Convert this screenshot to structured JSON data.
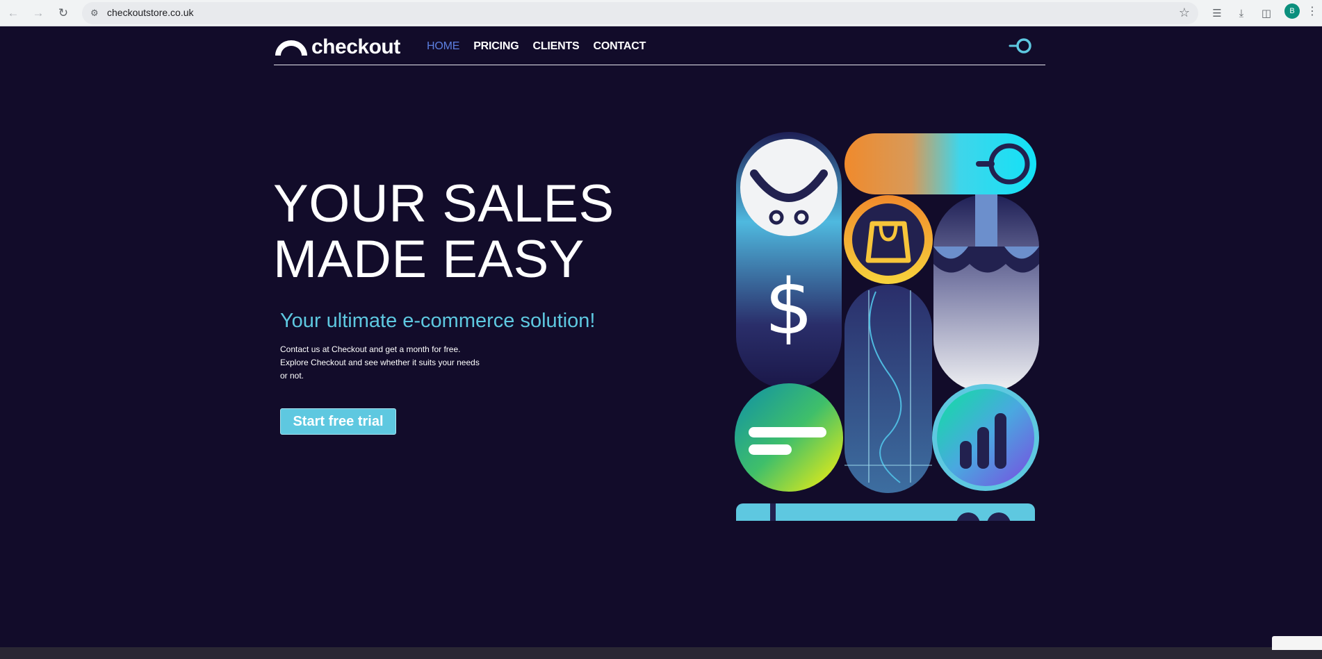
{
  "browser": {
    "url": "checkoutstore.co.uk",
    "profile_initial": "B"
  },
  "site": {
    "logo_text": "checkout",
    "nav": [
      {
        "label": "HOME",
        "active": true
      },
      {
        "label": "PRICING",
        "active": false
      },
      {
        "label": "CLIENTS",
        "active": false
      },
      {
        "label": "CONTACT",
        "active": false
      }
    ]
  },
  "hero": {
    "title_line1": "YOUR SALES",
    "title_line2": "MADE EASY",
    "subtitle": "Your ultimate e-commerce solution!",
    "description": "Contact us at Checkout and get a month for free. Explore Checkout and see whether it suits your needs or not.",
    "cta_label": "Start free trial"
  },
  "colors": {
    "background": "#120c2a",
    "accent": "#5ec8e0",
    "active_nav": "#5c7fe0"
  }
}
